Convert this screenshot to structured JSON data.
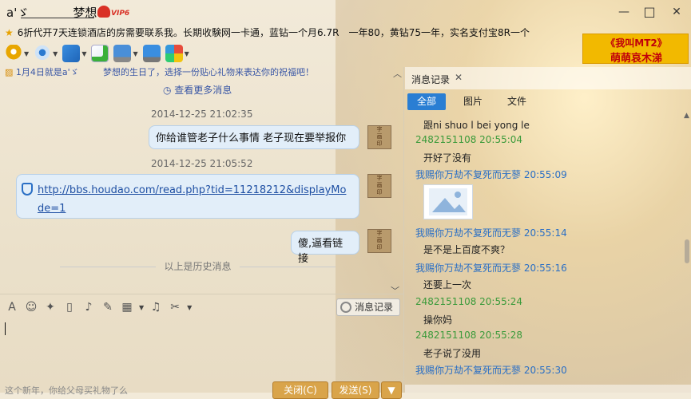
{
  "window": {
    "title_prefix": "a'ゞ",
    "title_name": "梦想",
    "vip_level": "VIP6",
    "minimize": "—",
    "maximize": "□",
    "close": "✕"
  },
  "marquee": "6折代开7天连锁酒店的房需要联系我。长期收験网一卡通，蓝钻一个月6.7R　一年80，黄钻75一年，实名支付宝8R一个",
  "toolbar": {
    "items": [
      "mic-icon",
      "camera-icon",
      "file-transfer-icon",
      "add-app-icon",
      "remote-desktop-icon",
      "screen-share-icon",
      "app-grid-icon"
    ]
  },
  "ad": {
    "line1": "《我叫MT2》",
    "line2": "萌萌哀木涕"
  },
  "notice": {
    "text": "1月4日就是a'ゞ",
    "gift": "梦想的生日了，选择一份贴心礼物来表达你的祝福吧！"
  },
  "chat": {
    "more": "查看更多消息",
    "messages": [
      {
        "time": "2014-12-25 21:02:35",
        "text": "你给谁管老子什么事情  老子现在要举报你"
      },
      {
        "time": "2014-12-25 21:05:52",
        "link": "http://bbs.houdao.com/read.php?tid=11218212&displayMode=1"
      },
      {
        "text": "傻,逼看链接"
      }
    ],
    "history_label": "以上是历史消息"
  },
  "input": {
    "msg_record": "消息记录",
    "hint": "这个新年，你给父母买礼物了么",
    "close_btn": "关闭(C)",
    "send_btn": "发送(S)"
  },
  "right_panel": {
    "tab_title": "消息记录",
    "filters": [
      "全部",
      "图片",
      "文件"
    ],
    "entries": [
      {
        "body": "跟ni  shuo l  bei yong le"
      },
      {
        "head": "2482151108 20:55:04",
        "color": "green",
        "body": "开好了没有"
      },
      {
        "head": "我赐你万劫不复死而无蓼 20:55:09",
        "color": "blue",
        "body": ""
      },
      {
        "head": "我赐你万劫不复死而无蓼 20:55:14",
        "color": "blue",
        "body": "是不是上百度不爽？"
      },
      {
        "head": "我赐你万劫不复死而无蓼 20:55:16",
        "color": "blue",
        "body": "还要上一次"
      },
      {
        "head": "2482151108 20:55:24",
        "color": "green",
        "body": "操你妈"
      },
      {
        "head": "2482151108 20:55:28",
        "color": "green",
        "body": "老子说了没用"
      },
      {
        "head": "我赐你万劫不复死而无蓼 20:55:30",
        "color": "blue",
        "body": ""
      }
    ]
  }
}
